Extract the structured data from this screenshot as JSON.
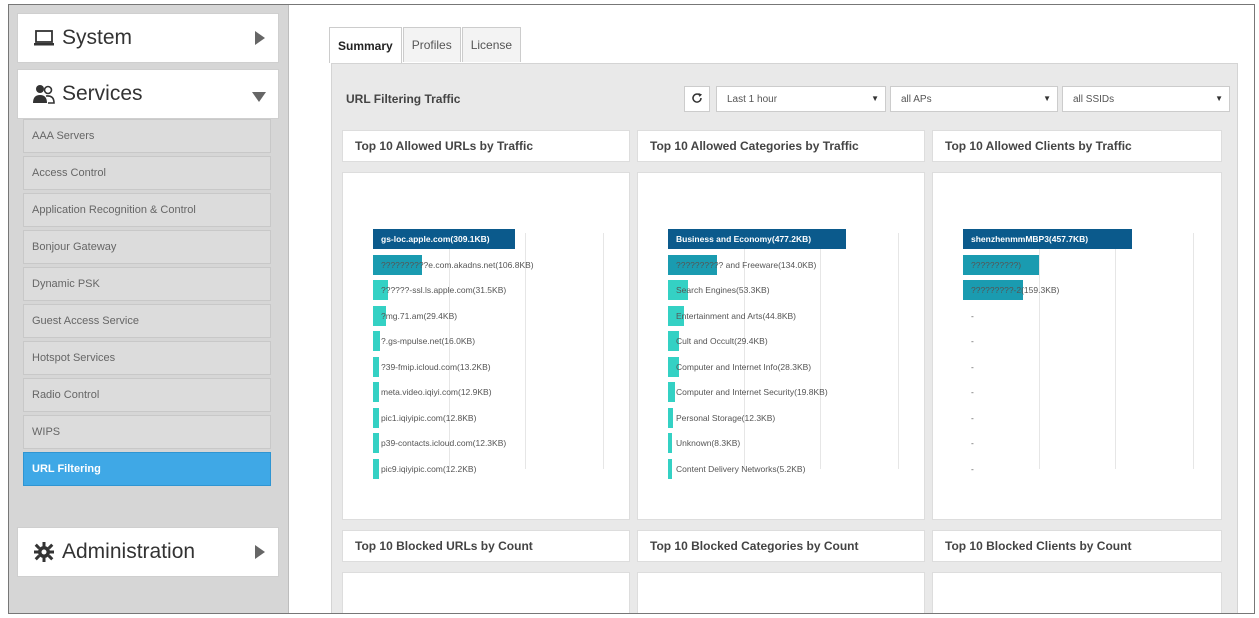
{
  "sidebar": {
    "system": {
      "label": "System",
      "icon": "laptop-icon",
      "arrow": "collapsed"
    },
    "services": {
      "label": "Services",
      "icon": "users-icon",
      "arrow": "expanded",
      "items": [
        {
          "label": "AAA Servers",
          "active": false
        },
        {
          "label": "Access Control",
          "active": false
        },
        {
          "label": "Application Recognition & Control",
          "active": false
        },
        {
          "label": "Bonjour Gateway",
          "active": false
        },
        {
          "label": "Dynamic PSK",
          "active": false
        },
        {
          "label": "Guest Access Service",
          "active": false
        },
        {
          "label": "Hotspot Services",
          "active": false
        },
        {
          "label": "Radio Control",
          "active": false
        },
        {
          "label": "WIPS",
          "active": false
        },
        {
          "label": "URL Filtering",
          "active": true
        }
      ]
    },
    "administration": {
      "label": "Administration",
      "icon": "gear-icon",
      "arrow": "collapsed"
    }
  },
  "tabs": [
    {
      "label": "Summary",
      "active": true
    },
    {
      "label": "Profiles",
      "active": false
    },
    {
      "label": "License",
      "active": false
    }
  ],
  "panel": {
    "title": "URL Filtering Traffic",
    "refresh_icon": "refresh-icon",
    "time_select": "Last 1 hour",
    "ap_select": "all APs",
    "ssid_select": "all SSIDs"
  },
  "colors": {
    "dark_bar": "#0b5a8c",
    "mid_bar": "#1a9bb0",
    "light_bar": "#34d1c4",
    "active_menu": "#3fa8e6"
  },
  "cards": [
    {
      "title": "Top 10 Allowed URLs by Traffic",
      "bars": [
        {
          "label": "gs-loc.apple.com(309.1KB)",
          "fraction": 0.78
        },
        {
          "label": "??????????e.com.akadns.net(106.8KB)",
          "fraction": 0.27
        },
        {
          "label": "??????-ssl.ls.apple.com(31.5KB)",
          "fraction": 0.08
        },
        {
          "label": "?mg.71.am(29.4KB)",
          "fraction": 0.07
        },
        {
          "label": "?.gs-mpulse.net(16.0KB)",
          "fraction": 0.04
        },
        {
          "label": "?39-fmip.icloud.com(13.2KB)",
          "fraction": 0.035
        },
        {
          "label": "meta.video.iqiyi.com(12.9KB)",
          "fraction": 0.033
        },
        {
          "label": "pic1.iqiyipic.com(12.8KB)",
          "fraction": 0.032
        },
        {
          "label": "p39-contacts.icloud.com(12.3KB)",
          "fraction": 0.031
        },
        {
          "label": "pic9.iqiyipic.com(12.2KB)",
          "fraction": 0.031
        }
      ]
    },
    {
      "title": "Top 10 Allowed Categories by Traffic",
      "bars": [
        {
          "label": "Business and Economy(477.2KB)",
          "fraction": 0.98
        },
        {
          "label": "?????????? and Freeware(134.0KB)",
          "fraction": 0.27
        },
        {
          "label": "Search Engines(53.3KB)",
          "fraction": 0.11
        },
        {
          "label": "Entertainment and Arts(44.8KB)",
          "fraction": 0.09
        },
        {
          "label": "Cult and Occult(29.4KB)",
          "fraction": 0.06
        },
        {
          "label": "Computer and Internet Info(28.3KB)",
          "fraction": 0.058
        },
        {
          "label": "Computer and Internet Security(19.8KB)",
          "fraction": 0.04
        },
        {
          "label": "Personal Storage(12.3KB)",
          "fraction": 0.025
        },
        {
          "label": "Unknown(8.3KB)",
          "fraction": 0.017
        },
        {
          "label": "Content Delivery Networks(5.2KB)",
          "fraction": 0.01
        }
      ]
    },
    {
      "title": "Top 10 Allowed Clients by Traffic",
      "bars": [
        {
          "label": "shenzhenmmMBP3(457.7KB)",
          "fraction": 0.93
        },
        {
          "label": "??????????)",
          "fraction": 0.42
        },
        {
          "label": "?????????-2(159.3KB)",
          "fraction": 0.33
        },
        {
          "label": "-",
          "fraction": 0
        },
        {
          "label": "-",
          "fraction": 0
        },
        {
          "label": "-",
          "fraction": 0
        },
        {
          "label": "-",
          "fraction": 0
        },
        {
          "label": "-",
          "fraction": 0
        },
        {
          "label": "-",
          "fraction": 0
        },
        {
          "label": "-",
          "fraction": 0
        }
      ]
    }
  ],
  "blocked_cards": [
    {
      "title": "Top 10 Blocked URLs by Count"
    },
    {
      "title": "Top 10 Blocked Categories by Count"
    },
    {
      "title": "Top 10 Blocked Clients by Count"
    }
  ]
}
